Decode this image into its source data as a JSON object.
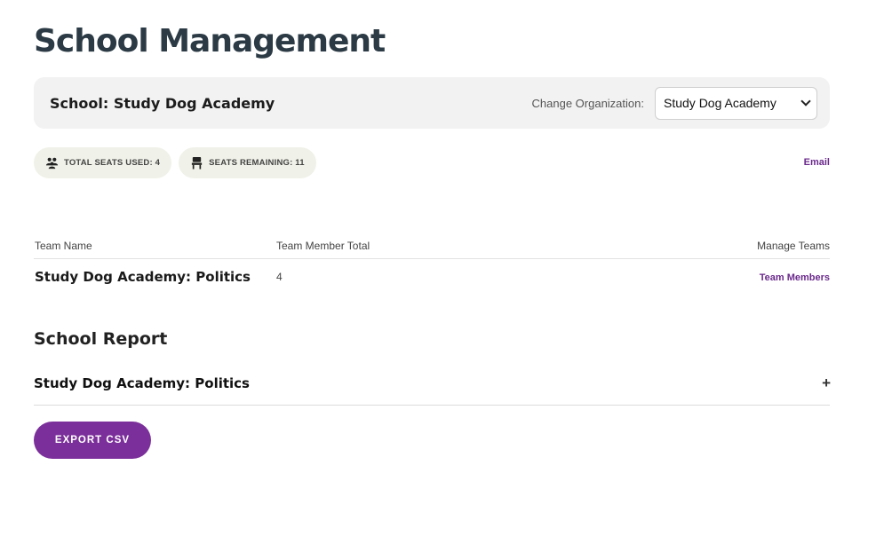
{
  "page": {
    "title": "School Management"
  },
  "school_bar": {
    "school_label": "School: Study Dog Academy",
    "change_org_label": "Change Organization:",
    "selected_org": "Study Dog Academy"
  },
  "badges": {
    "seats_used": "TOTAL SEATS USED: 4",
    "seats_remaining": "SEATS REMAINING: 11"
  },
  "email_link": "Email",
  "team_table": {
    "headers": [
      "Team Name",
      "Team Member Total",
      "Manage Teams"
    ],
    "rows": [
      {
        "name": "Study Dog Academy: Politics",
        "total": "4",
        "manage_link": "Team Members"
      }
    ]
  },
  "report": {
    "title": "School Report",
    "items": [
      {
        "name": "Study Dog Academy: Politics",
        "toggle": "+"
      }
    ]
  },
  "export_button": "EXPORT CSV",
  "colors": {
    "accent": "#7b2f9a",
    "link": "#6b2a8c",
    "title": "#2b3a44",
    "bar_bg": "#f2f2f2",
    "badge_bg": "#f0f1e8"
  },
  "icons": {
    "seats_used": "group-users-icon",
    "seats_remaining": "chair-icon"
  }
}
